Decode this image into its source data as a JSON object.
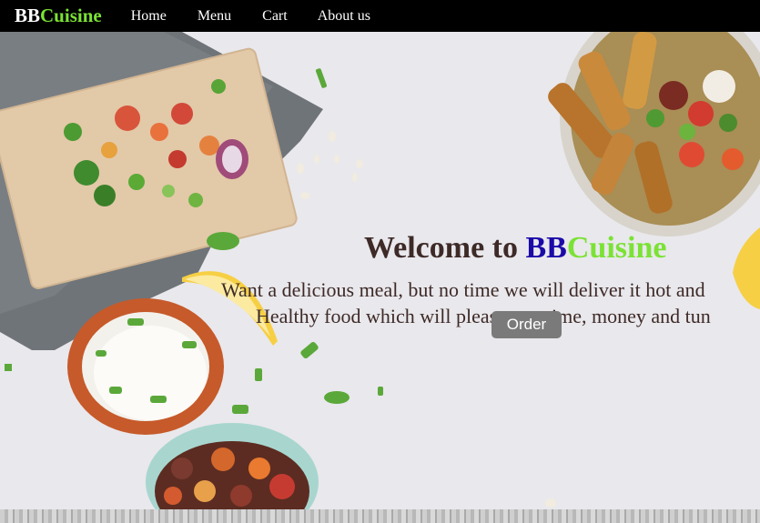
{
  "brand": {
    "bb": "BB",
    "cuisine": "Cuisine"
  },
  "nav": {
    "items": [
      {
        "label": "Home"
      },
      {
        "label": "Menu"
      },
      {
        "label": "Cart"
      },
      {
        "label": "About us"
      }
    ]
  },
  "hero": {
    "welcome_prefix": "Welcome to ",
    "welcome_bb": "BB",
    "welcome_cuisine": "Cuisine",
    "line1": "Want a delicious meal, but no time we will deliver it hot and",
    "line2": "Healthy food which will please you time, money and tun",
    "order_label": "Order"
  },
  "colors": {
    "nav_bg": "#000000",
    "brand_accent": "#7be235",
    "bb_blue": "#1b0aa8",
    "heading_text": "#3d2a27",
    "button_bg": "#7a7a7a"
  }
}
